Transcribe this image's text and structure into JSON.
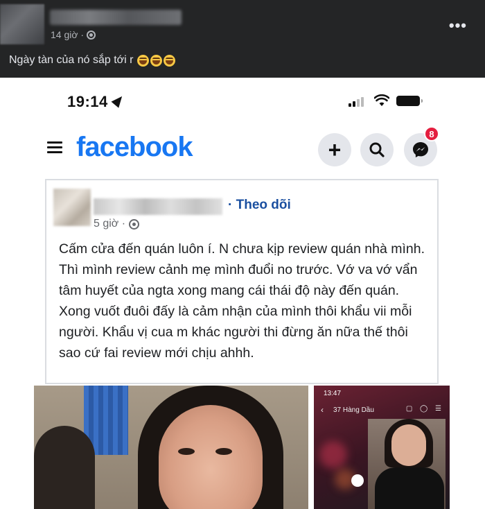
{
  "outer_post": {
    "timestamp": "14 giờ ·",
    "caption": "Ngày tàn của nó sắp tới r",
    "emoji_count": 3,
    "more_icon": "more-horizontal-icon"
  },
  "phone": {
    "status_time": "19:14",
    "app_logo": "facebook",
    "messenger_badge": "8",
    "colors": {
      "brand": "#1877f2",
      "badge": "#e41e3f"
    }
  },
  "inner_post": {
    "follow_label": "· Theo dõi",
    "timestamp": "5 giờ ·",
    "text": "Cấm cửa đến quán luôn í. N chưa kịp review quán nhà mình. Thì mình review cảnh mẹ mình đuổi no trước. Vớ va vớ vẩn tâm huyết của ngta xong mang cái thái độ này đến quán. Xong vuốt đuôi đấy là cảm nhận của mình thôi khẩu vii mỗi người. Khẩu vị cua m khác người thi đừng ăn nữa thế thôi sao cứ fai review mới chịu ahhh."
  },
  "right_image": {
    "time": "13:47",
    "title": "37 Hàng Dầu"
  }
}
